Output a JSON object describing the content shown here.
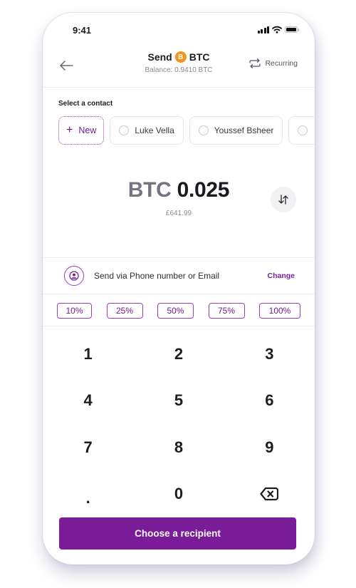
{
  "status_bar": {
    "time": "9:41",
    "icons": [
      "signal-icon",
      "wifi-icon",
      "battery-icon"
    ]
  },
  "header": {
    "back_icon": "arrow-left-icon",
    "title_prefix": "Send",
    "coin_symbol": "B",
    "title_suffix": "BTC",
    "balance": "Balance: 0.9410 BTC",
    "recurring_label": "Recurring",
    "recurring_icon": "repeat-icon"
  },
  "contacts": {
    "label": "Select a contact",
    "new_label": "New",
    "items": [
      {
        "name": "Luke Vella"
      },
      {
        "name": "Youssef Bsheer"
      },
      {
        "name": ""
      }
    ]
  },
  "amount": {
    "currency": "BTC",
    "value": "0.025",
    "fiat": "£641.99",
    "swap_icon": "swap-vertical-icon"
  },
  "send_via": {
    "icon": "user-circle-icon",
    "text": "Send via Phone number or Email",
    "change_label": "Change"
  },
  "percentages": [
    "10%",
    "25%",
    "50%",
    "75%",
    "100%"
  ],
  "keypad": [
    "1",
    "2",
    "3",
    "4",
    "5",
    "6",
    "7",
    "8",
    "9",
    ".",
    "0",
    "backspace"
  ],
  "cta": {
    "label": "Choose a recipient"
  },
  "colors": {
    "brand": "#7a1c97",
    "accent_border": "#9a3fc0",
    "btc": "#f7931a"
  }
}
